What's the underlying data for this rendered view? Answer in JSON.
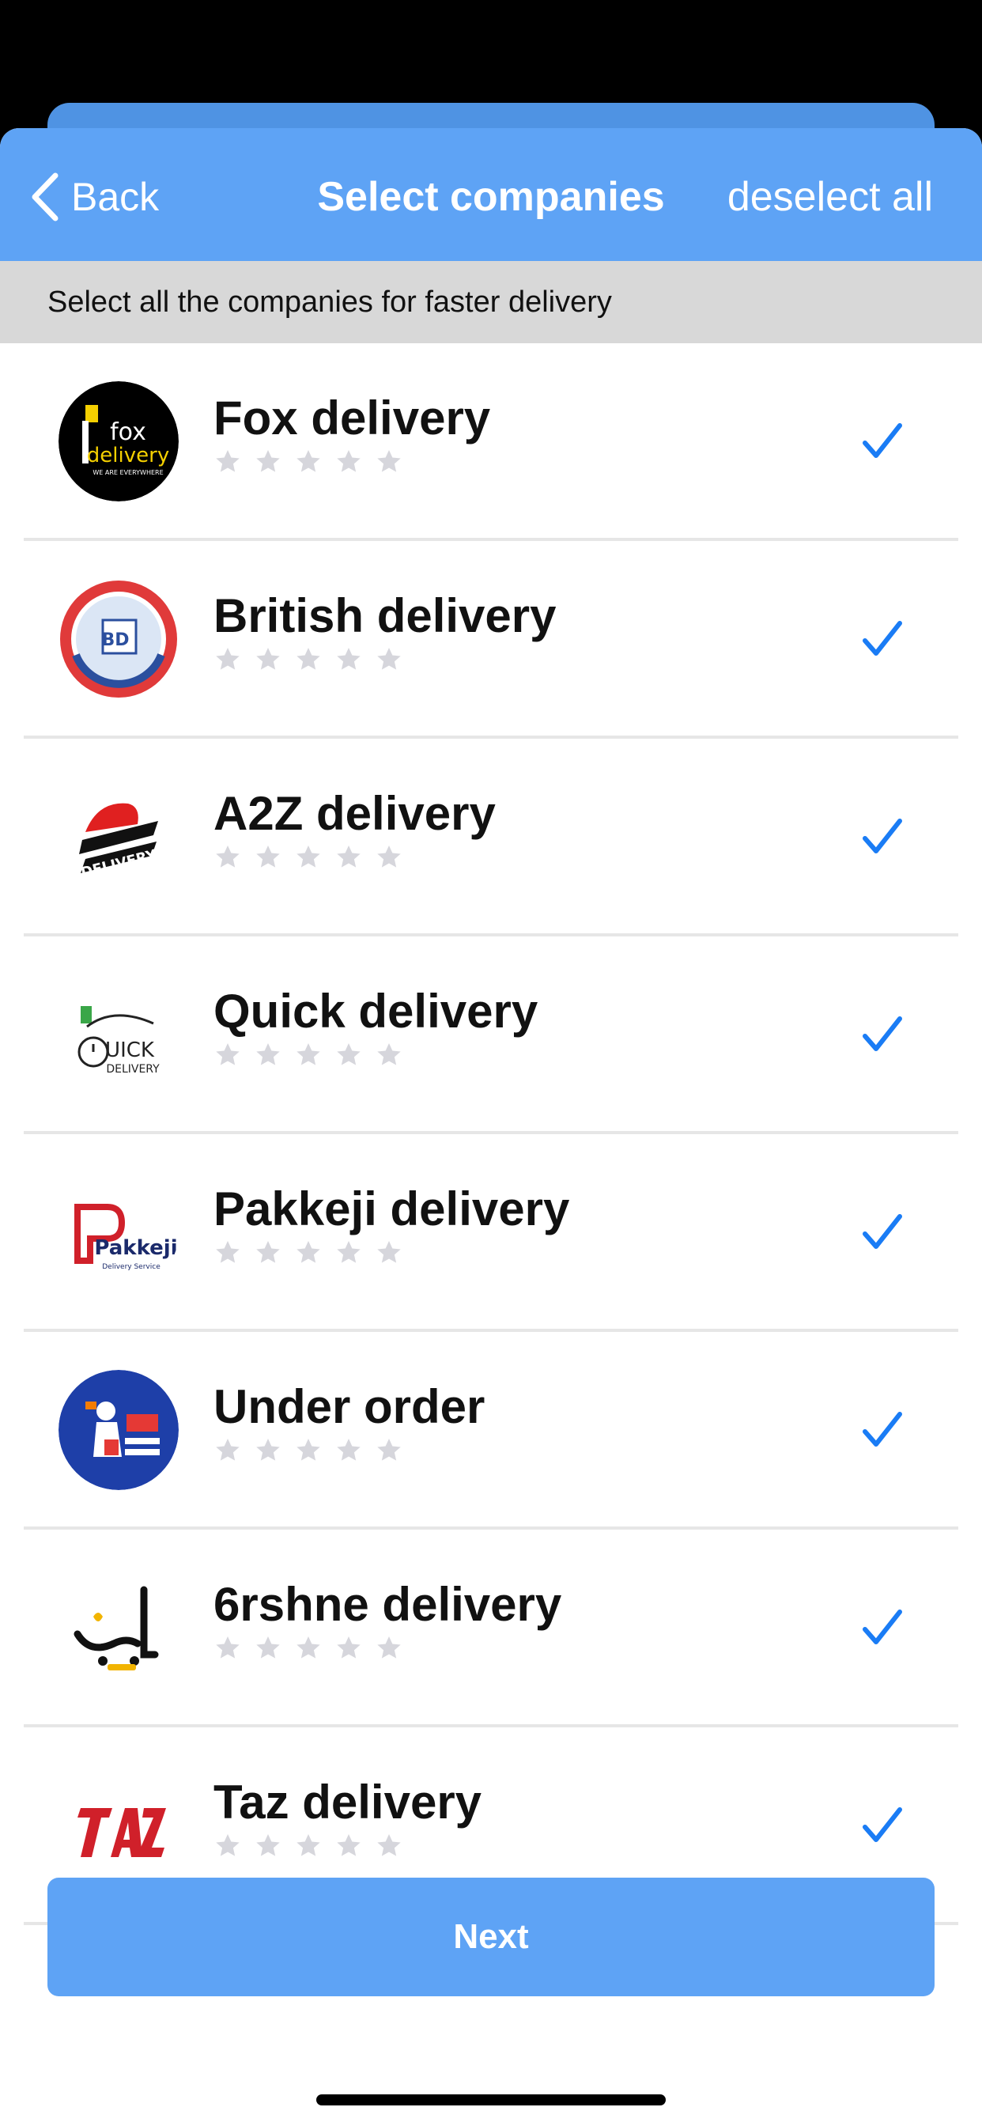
{
  "header": {
    "back_label": "Back",
    "title": "Select companies",
    "deselect_label": "deselect all"
  },
  "subheader": "Select all the companies for faster delivery",
  "companies": [
    {
      "name": "Fox delivery",
      "logo_icon": "fox-delivery-logo",
      "rating": 0,
      "selected": true
    },
    {
      "name": "British delivery",
      "logo_icon": "british-delivery-logo",
      "rating": 0,
      "selected": true
    },
    {
      "name": "A2Z delivery",
      "logo_icon": "a2z-delivery-logo",
      "rating": 0,
      "selected": true
    },
    {
      "name": "Quick delivery",
      "logo_icon": "quick-delivery-logo",
      "rating": 0,
      "selected": true
    },
    {
      "name": "Pakkeji delivery",
      "logo_icon": "pakkeji-delivery-logo",
      "rating": 0,
      "selected": true
    },
    {
      "name": "Under order",
      "logo_icon": "under-order-logo",
      "rating": 0,
      "selected": true
    },
    {
      "name": "6rshne delivery",
      "logo_icon": "6rshne-delivery-logo",
      "rating": 0,
      "selected": true
    },
    {
      "name": "Taz delivery",
      "logo_icon": "taz-delivery-logo",
      "rating": 0,
      "selected": true
    }
  ],
  "next_label": "Next",
  "colors": {
    "accent": "#5ea3f5",
    "check": "#1a7cf5",
    "star_empty": "#d6d6dc",
    "subheader_bg": "#d8d8d8"
  }
}
